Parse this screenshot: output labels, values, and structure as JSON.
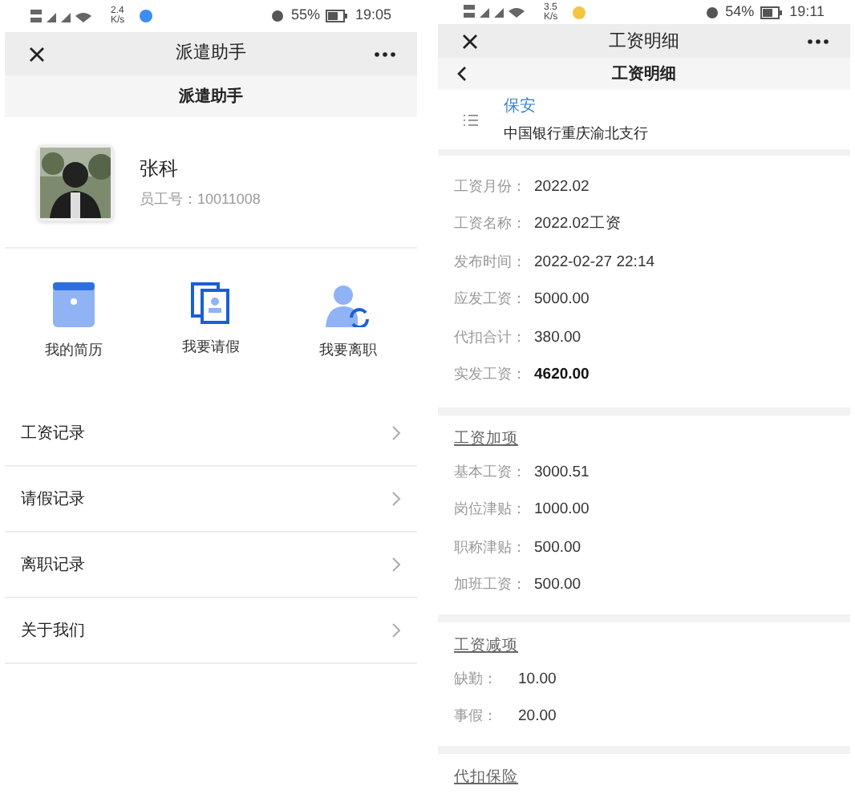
{
  "profile_screen": {
    "status_bar": {
      "speed": "2.4 K/s",
      "battery": "55%",
      "time": "19:05"
    },
    "title": "派遣助手",
    "header": "派遣助手",
    "profile": {
      "name": "张科",
      "employee_id": "员工号：10011008"
    },
    "shortcuts": [
      {
        "kind": "resume",
        "label": "我的简历"
      },
      {
        "kind": "leave",
        "label": "我要请假"
      },
      {
        "kind": "resign",
        "label": "我要离职"
      }
    ],
    "menu": [
      "工资记录",
      "请假记录",
      "离职记录",
      "关于我们"
    ]
  },
  "salary_screen": {
    "status_bar": {
      "speed": "3.5 K/s",
      "battery": "54%",
      "time": "19:11"
    },
    "title": "工资明细",
    "header": "工资明细",
    "job": {
      "position": "保安",
      "bank": "中国银行重庆渝北支行"
    },
    "summary": [
      {
        "label": "工资月份：",
        "value": "2022.02",
        "bold": false
      },
      {
        "label": "工资名称：",
        "value": "2022.02工资",
        "bold": false
      },
      {
        "label": "发布时间：",
        "value": "2022-02-27 22:14",
        "bold": false
      },
      {
        "label": "应发工资：",
        "value": "5000.00",
        "bold": false
      },
      {
        "label": "代扣合计：",
        "value": "380.00",
        "bold": false
      },
      {
        "label": "实发工资：",
        "value": "4620.00",
        "bold": true
      }
    ],
    "sections": [
      {
        "title": "工资加项",
        "items": [
          {
            "label": "基本工资：",
            "value": "3000.51"
          },
          {
            "label": "岗位津贴：",
            "value": "1000.00"
          },
          {
            "label": "职称津贴：",
            "value": "500.00"
          },
          {
            "label": "加班工资：",
            "value": "500.00"
          }
        ]
      },
      {
        "title": "工资减项",
        "items": [
          {
            "label": "缺勤：",
            "value": "10.00"
          },
          {
            "label": "事假：",
            "value": "20.00"
          }
        ]
      },
      {
        "title": "代扣保险"
      }
    ]
  }
}
